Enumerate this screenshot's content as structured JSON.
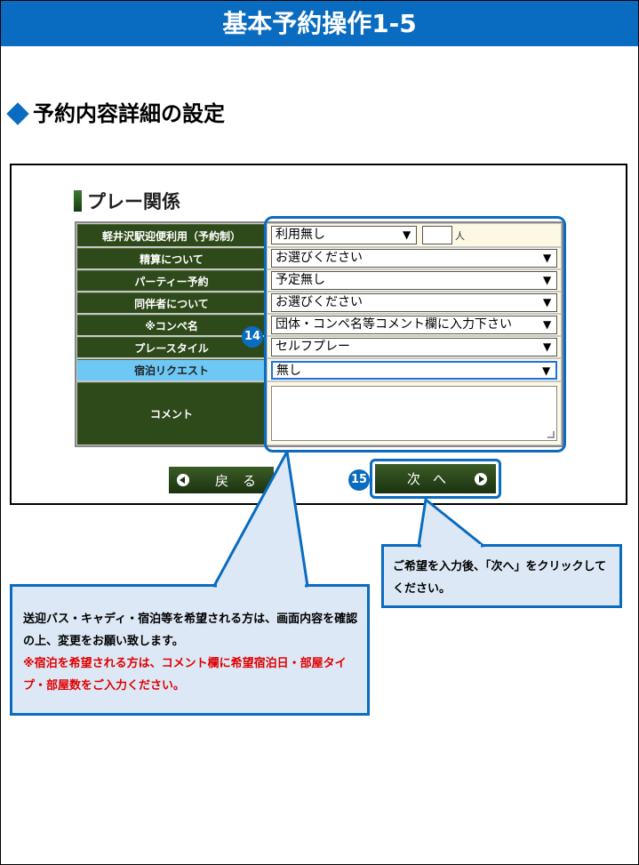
{
  "header": {
    "title": "基本予約操作1-5"
  },
  "section": {
    "heading": "予約内容詳細の設定"
  },
  "form": {
    "title": "プレー関係",
    "rows": [
      {
        "label": "軽井沢駅迎便利用（予約制）",
        "value": "利用無し",
        "unit": "人"
      },
      {
        "label": "精算について",
        "value": "お選びください"
      },
      {
        "label": "パーティー予約",
        "value": "予定無し"
      },
      {
        "label": "同伴者について",
        "value": "お選びください"
      },
      {
        "label": "※コンペ名",
        "value": "団体・コンペ名等コメント欄に入力下さい"
      },
      {
        "label": "プレースタイル",
        "value": "セルフプレー"
      },
      {
        "label": "宿泊リクエスト",
        "value": "無し"
      },
      {
        "label": "コメント",
        "value": ""
      }
    ]
  },
  "nav": {
    "back_label": "戻る",
    "next_label": "次へ"
  },
  "badges": {
    "form": "14",
    "next": "15"
  },
  "callouts": {
    "next": "ご希望を入力後、「次へ」をクリックしてください。",
    "main_text": "送迎バス・キャディ・宿泊等を希望される方は、画面内容を確認の上、変更をお願い致します。",
    "main_note": "※宿泊を希望される方は、コメント欄に希望宿泊日・部屋タイプ・部屋数をご入力ください。"
  },
  "colors": {
    "accent": "#0a6cc0",
    "label_bg": "#2e4a1a",
    "highlight_label": "#6ec8f6",
    "note_red": "#e00000"
  }
}
